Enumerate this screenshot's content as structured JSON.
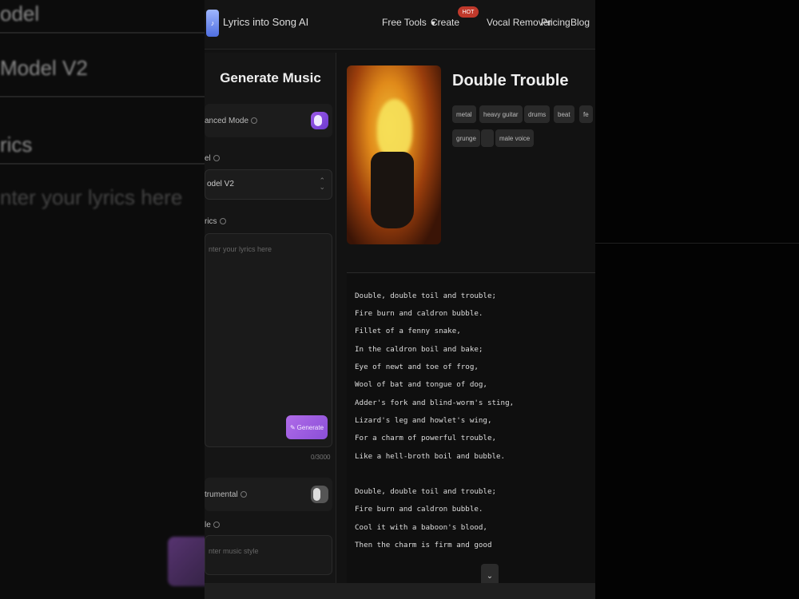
{
  "background": {
    "rows": [
      "odel",
      "Model V2",
      "rics",
      "nter your lyrics here"
    ]
  },
  "header": {
    "brand": "Lyrics into Song AI",
    "nav": {
      "free_tools": "Free Tools",
      "create": "Create",
      "hot_badge": "HOT",
      "vocal_remover": "Vocal Remover",
      "pricing": "Pricing",
      "blog": "Blog"
    }
  },
  "left_panel": {
    "title": "Generate Music",
    "advanced_mode_label": "anced Mode",
    "model_label": "el",
    "model_value": "odel V2",
    "lyrics_label": "rics",
    "lyrics_placeholder": "nter your lyrics here",
    "generate_button": "Generate",
    "char_counter": "0/3000",
    "instrumental_label": "trumental",
    "style_label": "le",
    "style_placeholder": "nter music style"
  },
  "song": {
    "title": "Double Trouble",
    "tags": [
      "metal",
      "heavy guitar",
      "drums",
      "beat",
      "fe",
      "grunge",
      "",
      "male voice"
    ]
  },
  "lyrics": [
    "Double, double toil and trouble;",
    "Fire burn and caldron bubble.",
    "Fillet of a fenny snake,",
    "In the caldron boil and bake;",
    "Eye of newt and toe of frog,",
    "Wool of bat and tongue of dog,",
    "Adder's fork and blind-worm's sting,",
    "Lizard's leg and howlet's wing,",
    "For a charm of powerful trouble,",
    "Like a hell-broth boil and bubble.",
    "Double, double toil and trouble;",
    "Fire burn and caldron bubble.",
    "Cool it with a baboon's blood,",
    "Then the charm is firm and good"
  ],
  "icons": {
    "scroll_down": "chevron-down-icon",
    "logo": "music-note-icon",
    "generate": "sparkle-icon"
  },
  "colors": {
    "accent": "#9b59e6",
    "hot": "#c0392b",
    "panel": "#151515"
  }
}
